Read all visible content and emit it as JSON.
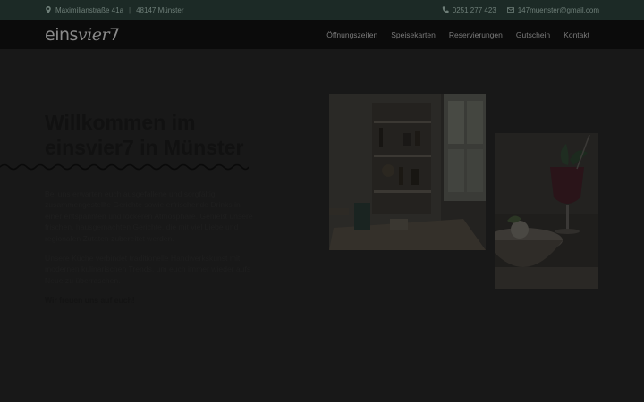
{
  "topbar": {
    "address": "Maximilianstraße 41a",
    "city": "48147 Münster",
    "phone": "0251 277 423",
    "email": "147muenster@gmail.com"
  },
  "nav": {
    "logo_prefix": "eins",
    "logo_script": "vier",
    "logo_suffix": "7",
    "items": [
      "Öffnungszeiten",
      "Speisekarten",
      "Reservierungen",
      "Gutschein",
      "Kontakt"
    ]
  },
  "hero": {
    "headline": "Willkommen im einsvier7 in Münster",
    "paragraph1": "Bei uns erwarten euch ausgefallene und sorgfältig zusammengestellte Gerichte sowie erfrischende Drinks in einer entspannten und lockeren Atmosphäre. Genießt unsere frischen, hausgemachten Gerichte, die mit viel Liebe und regionalen Zutaten zubereitet werden.",
    "paragraph2": "Unsere Küche verbindet traditionelle Handwerkskunst mit modernen kulinarischen Trends, um euch immer wieder aufs Neue zu überraschen.",
    "closing": "Wir freuen uns auf euch!"
  },
  "icons": {
    "location": "map-pin-icon",
    "phone": "phone-icon",
    "email": "envelope-icon"
  },
  "colors": {
    "topbar_bg": "#1c2a26",
    "nav_bg": "#0b0b0b",
    "content_bg": "#181818"
  }
}
